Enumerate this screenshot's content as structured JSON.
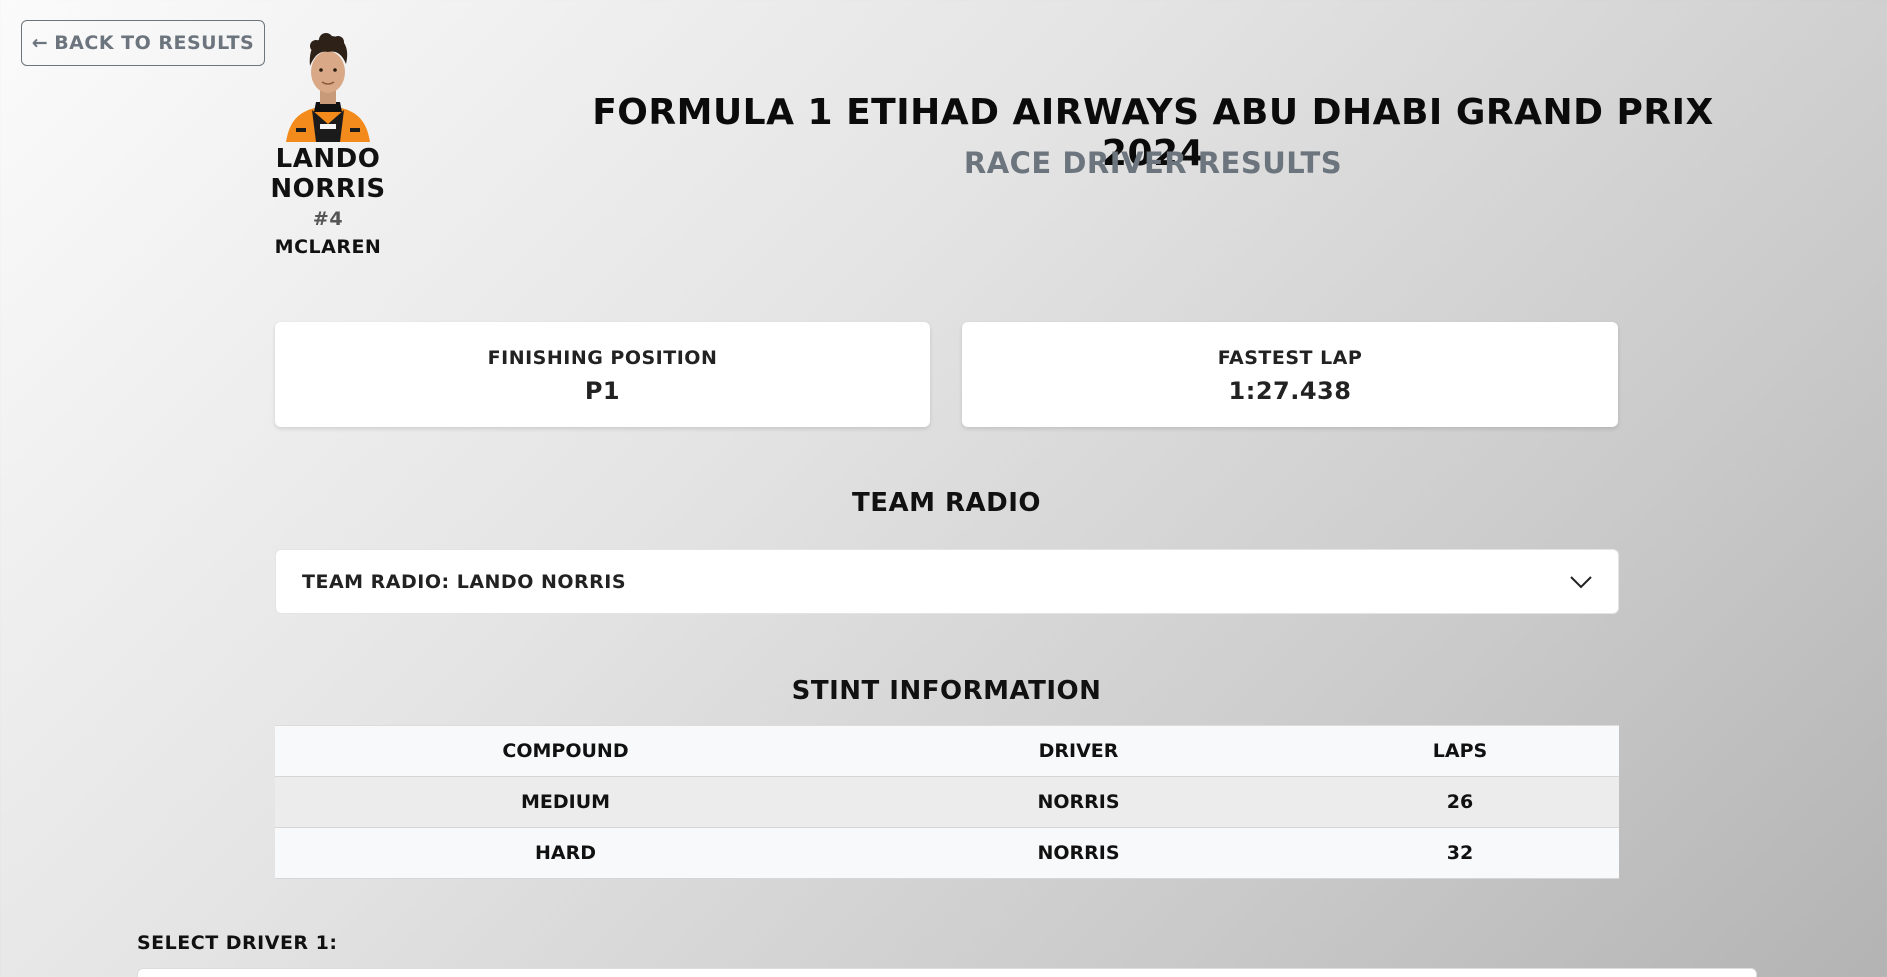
{
  "nav": {
    "back_arrow": "←",
    "back_label": "Back to Results"
  },
  "driver": {
    "name": "Lando Norris",
    "number": "#4",
    "team": "McLaren",
    "suit_color": "#f28a1c"
  },
  "header": {
    "title": "Formula 1 Etihad Airways Abu Dhabi Grand Prix 2024",
    "subtitle": "Race Driver Results"
  },
  "stats": {
    "finishing_label": "Finishing Position",
    "finishing_value": "P1",
    "fastest_label": "Fastest Lap",
    "fastest_value": "1:27.438"
  },
  "team_radio": {
    "section_title": "Team Radio",
    "accordion_label": "Team Radio: Lando Norris",
    "icon": "chevron-down-icon"
  },
  "stints": {
    "section_title": "Stint Information",
    "columns": [
      "Compound",
      "Driver",
      "Laps"
    ],
    "rows": [
      [
        "Medium",
        "Norris",
        "26"
      ],
      [
        "Hard",
        "Norris",
        "32"
      ]
    ]
  },
  "select_driver": {
    "label": "Select Driver 1:"
  }
}
